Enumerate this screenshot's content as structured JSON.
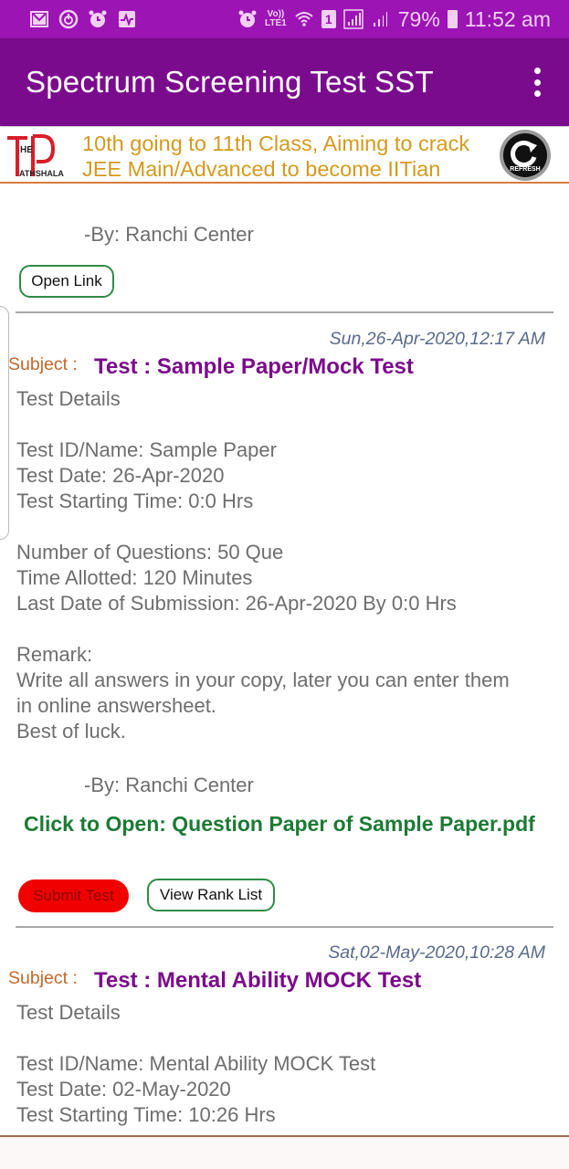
{
  "status_bar": {
    "left_icons": [
      "gmail-icon",
      "power-icon",
      "alarm-icon",
      "activity-icon"
    ],
    "right_icons": [
      "alarm-icon",
      "volte-icon",
      "wifi-icon",
      "sim1-icon",
      "signal-icon",
      "signal-weak-icon",
      "battery-icon"
    ],
    "volte_text_top": "Vo))",
    "volte_text_bottom": "LTE1",
    "sim_label": "1",
    "battery": "79%",
    "time": "11:52 am"
  },
  "app_bar": {
    "title": "Spectrum Screening Test SST",
    "overflow_icon": "more-vert-icon"
  },
  "banner": {
    "logo_text_top": "HE",
    "logo_text_bottom": "ATHSHALA",
    "line1": "10th going to 11th Class, Aiming to crack",
    "line2": "JEE Main/Advanced to become IITian",
    "refresh_label": "REFRESH"
  },
  "colors": {
    "status_bar": "#9c14b4",
    "app_bar": "#7a0b8c",
    "subject_title": "#7b0a8c",
    "subject_label": "#c0682a",
    "pdf_link": "#1c7a34",
    "submit_button": "#f20000",
    "banner_text": "#d49a1e"
  },
  "previous_post": {
    "by_line": "-By: Ranchi Center",
    "open_link_label": "Open Link"
  },
  "posts": [
    {
      "timestamp": "Sun,26-Apr-2020,12:17 AM",
      "subject_label": "Subject :",
      "subject_title": "Test : Sample Paper/Mock Test",
      "details_heading": "Test Details",
      "test_id": "Test ID/Name: Sample Paper",
      "test_date": "Test Date: 26-Apr-2020",
      "start_time": "Test Starting Time: 0:0 Hrs",
      "num_questions": "Number of Questions: 50 Que",
      "time_allotted": "Time Allotted: 120 Minutes",
      "last_date": "Last Date of Submission: 26-Apr-2020 By 0:0 Hrs",
      "remark_label": "Remark:",
      "remark_line1": "Write all answers in your copy, later you can enter them",
      "remark_line2": "in online answersheet.",
      "remark_line3": "Best of luck.",
      "by_line": "-By: Ranchi Center",
      "pdf_link": "Click to Open: Question Paper of Sample Paper.pdf",
      "submit_label": "Submit Test",
      "rank_label": "View Rank List"
    },
    {
      "timestamp": "Sat,02-May-2020,10:28 AM",
      "subject_label": "Subject :",
      "subject_title": "Test : Mental Ability MOCK Test",
      "details_heading": "Test Details",
      "test_id": "Test ID/Name: Mental Ability MOCK Test",
      "test_date": "Test Date: 02-May-2020",
      "start_time": "Test Starting Time: 10:26 Hrs"
    }
  ]
}
